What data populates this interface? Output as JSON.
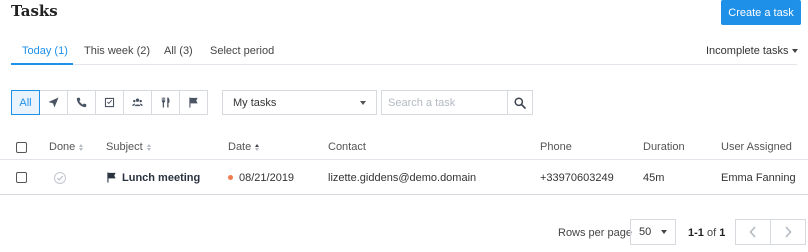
{
  "page": {
    "title": "Tasks"
  },
  "header": {
    "create_label": "Create a task",
    "accent": "#1e90e8"
  },
  "tabs": [
    {
      "label": "Today (1)",
      "active": true
    },
    {
      "label": "This week (2)",
      "active": false
    },
    {
      "label": "All (3)",
      "active": false
    },
    {
      "label": "Select period",
      "active": false
    }
  ],
  "status_filter": {
    "label": "Incomplete tasks"
  },
  "type_filters": {
    "all_label": "All",
    "icons": [
      "send-icon",
      "phone-icon",
      "checkbox-icon",
      "people-icon",
      "cutlery-icon",
      "flag-icon"
    ]
  },
  "owner_filter": {
    "selected": "My tasks"
  },
  "search": {
    "placeholder": "Search a task",
    "value": ""
  },
  "table": {
    "columns": [
      "Done",
      "Subject",
      "Date",
      "Contact",
      "Phone",
      "Duration",
      "User Assigned"
    ],
    "rows": [
      {
        "subject": "Lunch meeting",
        "subject_icon": "flag-icon",
        "date": "08/21/2019",
        "date_status_color": "#f07b4f",
        "contact": "lizette.giddens@demo.domain",
        "phone": "+33970603249",
        "duration": "45m",
        "user": "Emma Fanning"
      }
    ]
  },
  "pagination": {
    "rows_label": "Rows per page",
    "rows_value": "50",
    "range": "1-1",
    "of_label": "of",
    "total": "1"
  }
}
